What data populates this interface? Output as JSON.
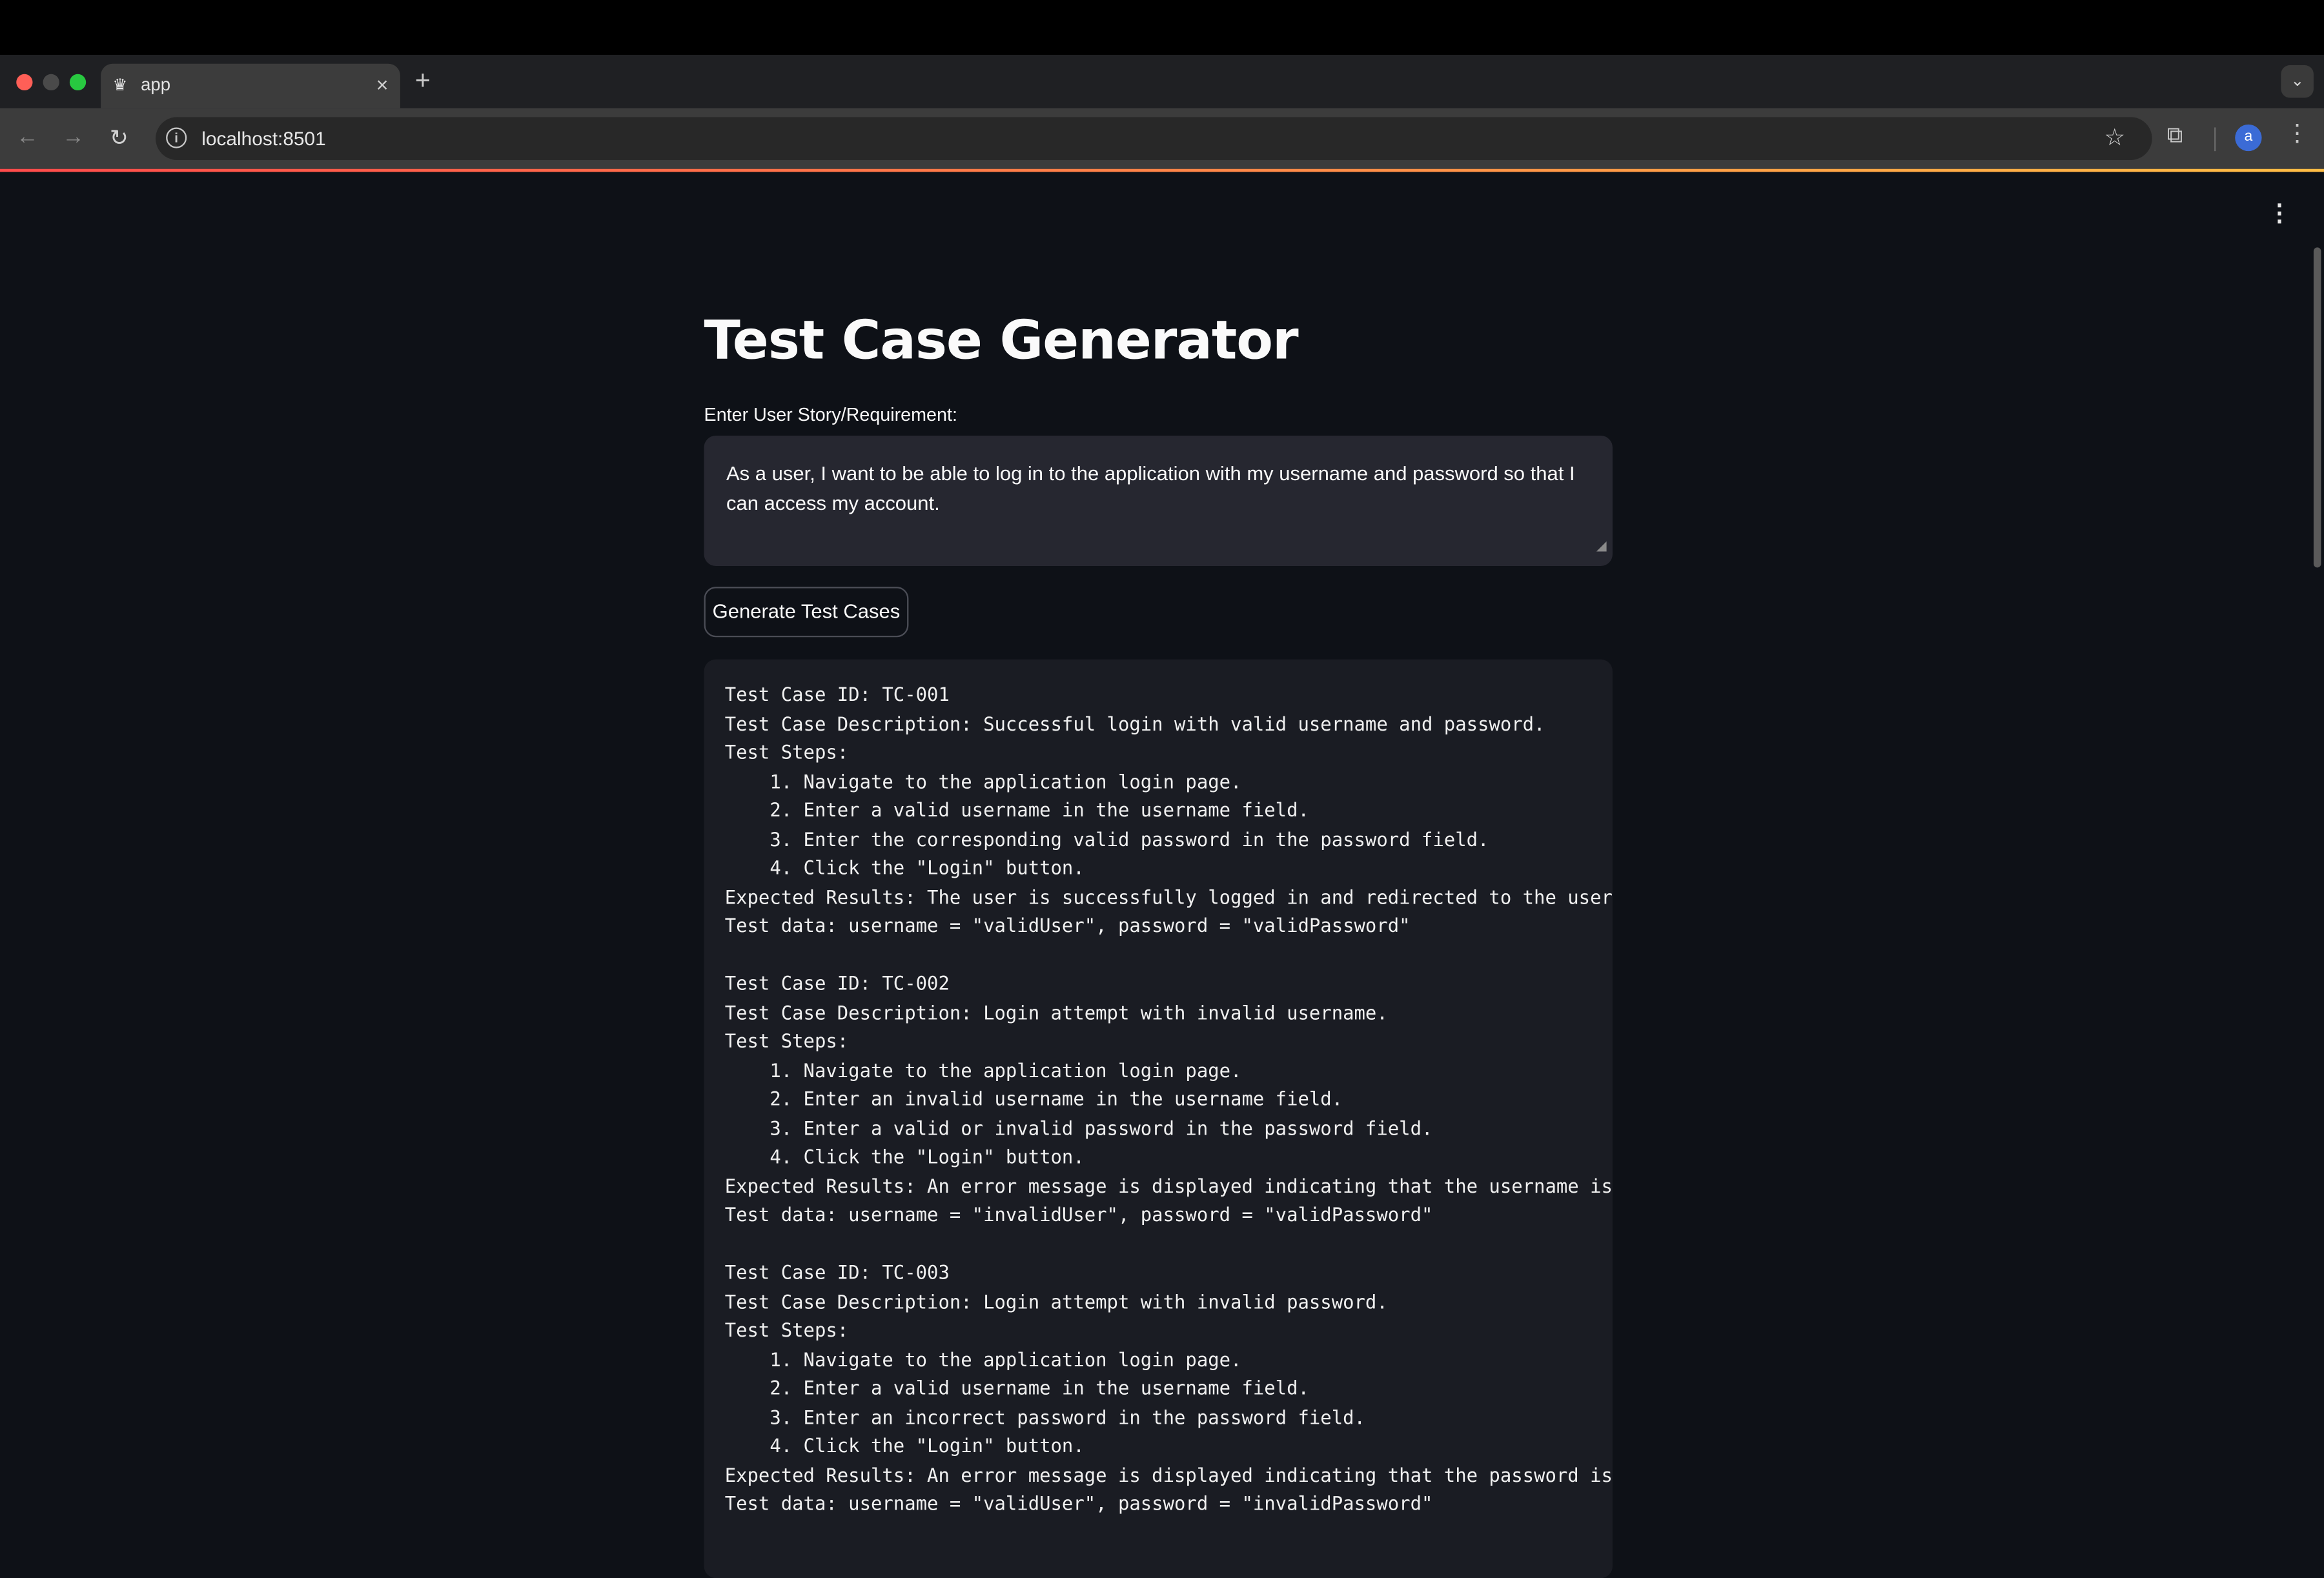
{
  "browser": {
    "tab_title": "app",
    "tab_icon": "crown-icon",
    "tab_close": "×",
    "new_tab": "+",
    "url": "localhost:8501",
    "profile_initial": "a"
  },
  "app": {
    "title": "Test Case Generator",
    "input_label": "Enter User Story/Requirement:",
    "input_value": "As a user, I want to be able to log in to the application with my username and password so that I can access my account.",
    "generate_button": "Generate Test Cases",
    "output_text": "Test Case ID: TC-001\nTest Case Description: Successful login with valid username and password.\nTest Steps:\n    1. Navigate to the application login page.\n    2. Enter a valid username in the username field.\n    3. Enter the corresponding valid password in the password field.\n    4. Click the \"Login\" button.\nExpected Results: The user is successfully logged in and redirected to the user's\nTest data: username = \"validUser\", password = \"validPassword\"\n\nTest Case ID: TC-002\nTest Case Description: Login attempt with invalid username.\nTest Steps:\n    1. Navigate to the application login page.\n    2. Enter an invalid username in the username field.\n    3. Enter a valid or invalid password in the password field.\n    4. Click the \"Login\" button.\nExpected Results: An error message is displayed indicating that the username is in\nTest data: username = \"invalidUser\", password = \"validPassword\"\n\nTest Case ID: TC-003\nTest Case Description: Login attempt with invalid password.\nTest Steps:\n    1. Navigate to the application login page.\n    2. Enter a valid username in the username field.\n    3. Enter an incorrect password in the password field.\n    4. Click the \"Login\" button.\nExpected Results: An error message is displayed indicating that the password is in\nTest data: username = \"validUser\", password = \"invalidPassword\""
  },
  "colors": {
    "background": "#0e1117",
    "code_background": "#1a1c23",
    "input_background": "#262730",
    "accent_gradient_start": "#ff4b4b",
    "accent_gradient_end": "#ffbd45"
  }
}
